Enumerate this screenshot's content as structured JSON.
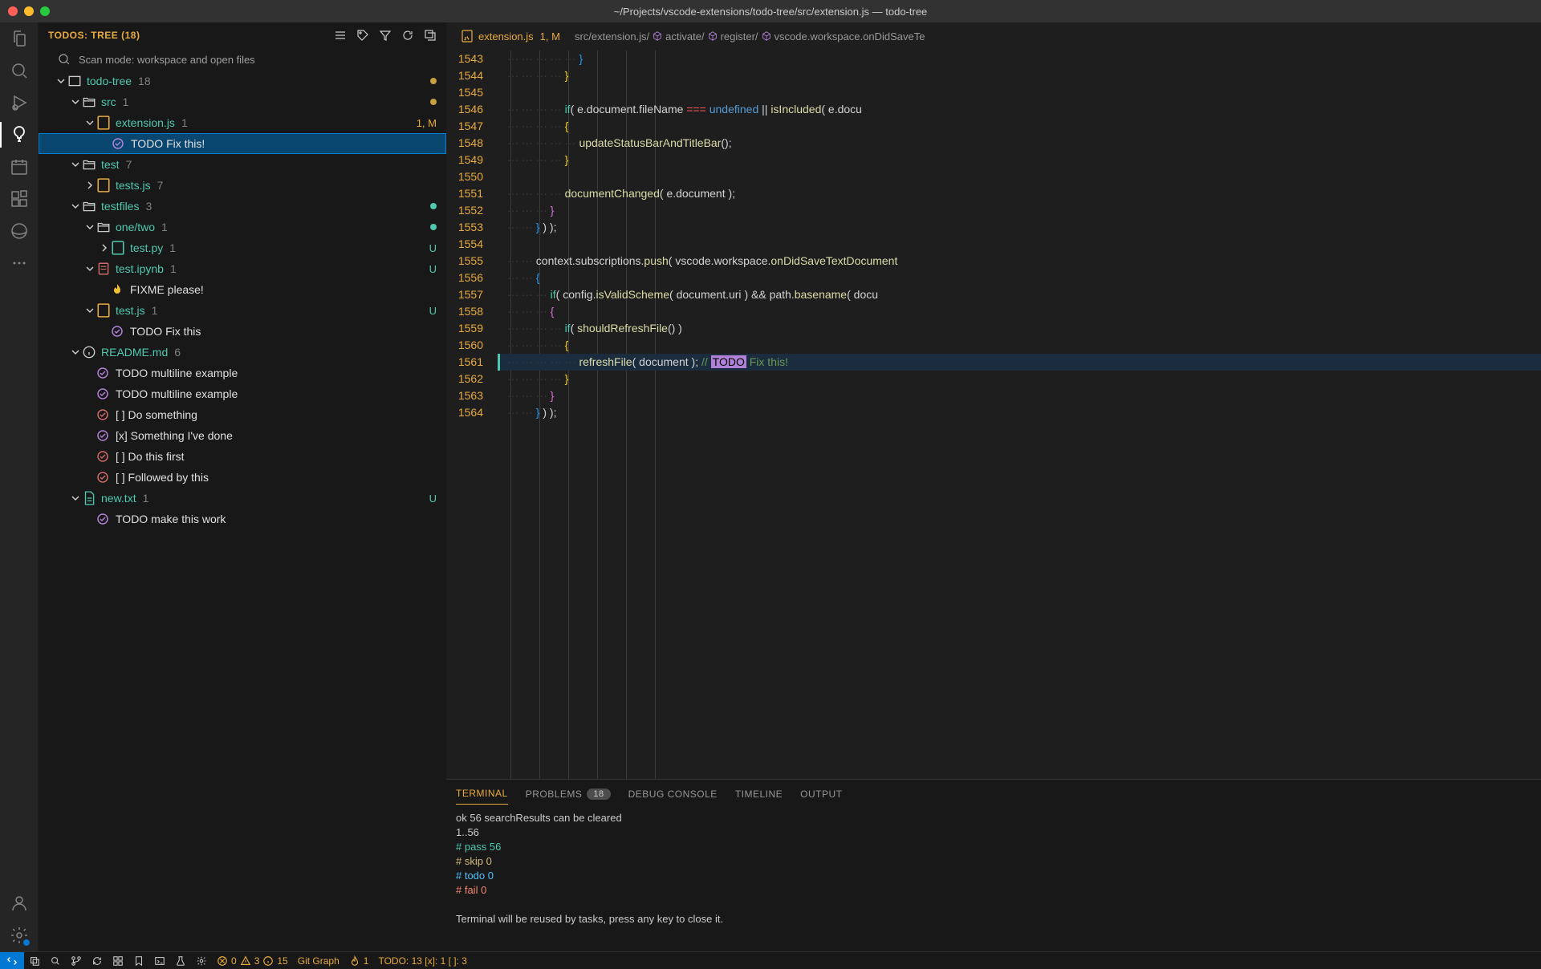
{
  "window": {
    "title": "~/Projects/vscode-extensions/todo-tree/src/extension.js — todo-tree"
  },
  "sidebar": {
    "title": "TODOS: TREE (18)",
    "scan_label": "Scan mode: workspace and open files",
    "tree": [
      {
        "indent": 0,
        "type": "folder-root",
        "chevron": "down",
        "icon": "project",
        "label": "todo-tree",
        "count": "18",
        "status": "dot-yellow"
      },
      {
        "indent": 1,
        "type": "folder",
        "chevron": "down",
        "icon": "folder-open",
        "label": "src",
        "count": "1",
        "status": "dot-yellow"
      },
      {
        "indent": 2,
        "type": "file",
        "chevron": "down",
        "icon": "js",
        "label": "extension.js",
        "count": "1",
        "status": "1, M",
        "status_class": "modified"
      },
      {
        "indent": 3,
        "type": "todo",
        "icon": "check-circle",
        "icon_color": "#b180d7",
        "label": "TODO Fix this!",
        "selected": true
      },
      {
        "indent": 1,
        "type": "folder",
        "chevron": "down",
        "icon": "folder-open",
        "label": "test",
        "count": "7"
      },
      {
        "indent": 2,
        "type": "file",
        "chevron": "right",
        "icon": "js",
        "label": "tests.js",
        "count": "7"
      },
      {
        "indent": 1,
        "type": "folder",
        "chevron": "down",
        "icon": "folder-open",
        "label": "testfiles",
        "count": "3",
        "status": "dot-green"
      },
      {
        "indent": 2,
        "type": "folder",
        "chevron": "down",
        "icon": "folder-open",
        "label": "one/two",
        "count": "1",
        "status": "dot-green"
      },
      {
        "indent": 3,
        "type": "file",
        "chevron": "right",
        "icon": "py",
        "label": "test.py",
        "count": "1",
        "status": "U"
      },
      {
        "indent": 2,
        "type": "file",
        "chevron": "down",
        "icon": "ipynb",
        "label": "test.ipynb",
        "count": "1",
        "status": "U"
      },
      {
        "indent": 3,
        "type": "todo",
        "icon": "flame",
        "icon_color": "#f0c030",
        "label": "FIXME please!"
      },
      {
        "indent": 2,
        "type": "file",
        "chevron": "down",
        "icon": "js",
        "label": "test.js",
        "count": "1",
        "status": "U"
      },
      {
        "indent": 3,
        "type": "todo",
        "icon": "check-circle",
        "icon_color": "#b180d7",
        "label": "TODO Fix this"
      },
      {
        "indent": 1,
        "type": "file",
        "chevron": "down",
        "icon": "info",
        "label": "README.md",
        "count": "6"
      },
      {
        "indent": 2,
        "type": "todo",
        "icon": "check-circle",
        "icon_color": "#b180d7",
        "label": "TODO multiline example"
      },
      {
        "indent": 2,
        "type": "todo",
        "icon": "check-circle",
        "icon_color": "#b180d7",
        "label": "TODO multiline example"
      },
      {
        "indent": 2,
        "type": "todo",
        "icon": "check-bad",
        "icon_color": "#d16969",
        "label": "[ ] Do something"
      },
      {
        "indent": 2,
        "type": "todo",
        "icon": "check-circle",
        "icon_color": "#b180d7",
        "label": "[x] Something I've done"
      },
      {
        "indent": 2,
        "type": "todo",
        "icon": "check-bad",
        "icon_color": "#d16969",
        "label": "[ ] Do this first"
      },
      {
        "indent": 2,
        "type": "todo",
        "icon": "check-bad",
        "icon_color": "#d16969",
        "label": "[ ] Followed by this"
      },
      {
        "indent": 1,
        "type": "file",
        "chevron": "down",
        "icon": "txt",
        "label": "new.txt",
        "count": "1",
        "status": "U"
      },
      {
        "indent": 2,
        "type": "todo",
        "icon": "check-circle",
        "icon_color": "#b180d7",
        "label": "TODO make this work"
      }
    ]
  },
  "editor": {
    "tab": {
      "filename": "extension.js",
      "status": "1, M"
    },
    "breadcrumb": [
      "src/extension.js/",
      "activate/",
      "register/",
      "vscode.workspace.onDidSaveTe"
    ],
    "lines": [
      {
        "n": 1543,
        "indent": 20,
        "tokens": [
          {
            "t": "}",
            "c": "brace2"
          }
        ]
      },
      {
        "n": 1544,
        "indent": 16,
        "tokens": [
          {
            "t": "}",
            "c": "brace3"
          }
        ]
      },
      {
        "n": 1545,
        "indent": 0,
        "tokens": []
      },
      {
        "n": 1546,
        "indent": 16,
        "tokens": [
          {
            "t": "if",
            "c": "fn"
          },
          {
            "t": "( ",
            "c": "op"
          },
          {
            "t": "e.document.fileName ",
            "c": "op"
          },
          {
            "t": "=== ",
            "c": "eq"
          },
          {
            "t": "undefined ",
            "c": "undef"
          },
          {
            "t": "|| ",
            "c": "op"
          },
          {
            "t": "isIncluded",
            "c": "call"
          },
          {
            "t": "( ",
            "c": "op"
          },
          {
            "t": "e.docu",
            "c": "op"
          }
        ]
      },
      {
        "n": 1547,
        "indent": 16,
        "tokens": [
          {
            "t": "{",
            "c": "brace3"
          }
        ]
      },
      {
        "n": 1548,
        "indent": 20,
        "tokens": [
          {
            "t": "updateStatusBarAndTitleBar",
            "c": "call"
          },
          {
            "t": "();",
            "c": "op"
          }
        ]
      },
      {
        "n": 1549,
        "indent": 16,
        "tokens": [
          {
            "t": "}",
            "c": "brace3"
          }
        ]
      },
      {
        "n": 1550,
        "indent": 0,
        "tokens": []
      },
      {
        "n": 1551,
        "indent": 16,
        "tokens": [
          {
            "t": "documentChanged",
            "c": "call"
          },
          {
            "t": "( ",
            "c": "op"
          },
          {
            "t": "e.document ",
            "c": "op"
          },
          {
            "t": ");",
            "c": "op"
          }
        ]
      },
      {
        "n": 1552,
        "indent": 12,
        "tokens": [
          {
            "t": "}",
            "c": "brace"
          }
        ]
      },
      {
        "n": 1553,
        "indent": 8,
        "tokens": [
          {
            "t": "} ",
            "c": "brace2"
          },
          {
            "t": ") );",
            "c": "op"
          }
        ]
      },
      {
        "n": 1554,
        "indent": 0,
        "tokens": []
      },
      {
        "n": 1555,
        "indent": 8,
        "tokens": [
          {
            "t": "context.subscriptions.",
            "c": "op"
          },
          {
            "t": "push",
            "c": "call"
          },
          {
            "t": "( ",
            "c": "op"
          },
          {
            "t": "vscode.workspace.",
            "c": "op"
          },
          {
            "t": "onDidSaveTextDocument",
            "c": "call"
          }
        ]
      },
      {
        "n": 1556,
        "indent": 8,
        "tokens": [
          {
            "t": "{",
            "c": "brace2"
          }
        ]
      },
      {
        "n": 1557,
        "indent": 12,
        "tokens": [
          {
            "t": "if",
            "c": "fn"
          },
          {
            "t": "( ",
            "c": "op"
          },
          {
            "t": "config.",
            "c": "op"
          },
          {
            "t": "isValidScheme",
            "c": "call"
          },
          {
            "t": "( ",
            "c": "op"
          },
          {
            "t": "document.uri ",
            "c": "op"
          },
          {
            "t": ") ",
            "c": "op"
          },
          {
            "t": "&& ",
            "c": "op"
          },
          {
            "t": "path.",
            "c": "op"
          },
          {
            "t": "basename",
            "c": "call"
          },
          {
            "t": "( docu",
            "c": "op"
          }
        ]
      },
      {
        "n": 1558,
        "indent": 12,
        "tokens": [
          {
            "t": "{",
            "c": "brace"
          }
        ]
      },
      {
        "n": 1559,
        "indent": 16,
        "tokens": [
          {
            "t": "if",
            "c": "fn"
          },
          {
            "t": "( ",
            "c": "op"
          },
          {
            "t": "shouldRefreshFile",
            "c": "call"
          },
          {
            "t": "() )",
            "c": "op"
          }
        ]
      },
      {
        "n": 1560,
        "indent": 16,
        "tokens": [
          {
            "t": "{",
            "c": "brace3"
          }
        ]
      },
      {
        "n": 1561,
        "indent": 20,
        "hl": true,
        "cursor": true,
        "tokens": [
          {
            "t": "refreshFile",
            "c": "call"
          },
          {
            "t": "( ",
            "c": "op"
          },
          {
            "t": "document ",
            "c": "op"
          },
          {
            "t": "); ",
            "c": "op"
          },
          {
            "t": "// ",
            "c": "cmt"
          },
          {
            "t": "TODO",
            "c": "todo-kw"
          },
          {
            "t": " Fix this!",
            "c": "cmt"
          }
        ]
      },
      {
        "n": 1562,
        "indent": 16,
        "tokens": [
          {
            "t": "}",
            "c": "brace3"
          }
        ]
      },
      {
        "n": 1563,
        "indent": 12,
        "tokens": [
          {
            "t": "}",
            "c": "brace"
          }
        ]
      },
      {
        "n": 1564,
        "indent": 8,
        "tokens": [
          {
            "t": "} ",
            "c": "brace2"
          },
          {
            "t": ") );",
            "c": "op"
          }
        ]
      }
    ]
  },
  "panel": {
    "tabs": [
      {
        "label": "TERMINAL",
        "active": true
      },
      {
        "label": "PROBLEMS",
        "badge": "18"
      },
      {
        "label": "DEBUG CONSOLE"
      },
      {
        "label": "TIMELINE"
      },
      {
        "label": "OUTPUT"
      }
    ],
    "terminal": [
      {
        "text": "ok 56 searchResults can be cleared",
        "class": ""
      },
      {
        "text": "1..56",
        "class": ""
      },
      {
        "text": "# pass 56",
        "class": "term-green"
      },
      {
        "text": "# skip 0",
        "class": "term-yellow"
      },
      {
        "text": "# todo 0",
        "class": "term-cyan"
      },
      {
        "text": "# fail 0",
        "class": "term-red"
      },
      {
        "text": "",
        "class": ""
      },
      {
        "text": "Terminal will be reused by tasks, press any key to close it.",
        "class": ""
      }
    ]
  },
  "statusbar": {
    "errors": "0",
    "warnings": "3",
    "info": "15",
    "gitgraph": "Git Graph",
    "flame": "1",
    "todos": "TODO: 13  [x]: 1  [ ]: 3"
  }
}
